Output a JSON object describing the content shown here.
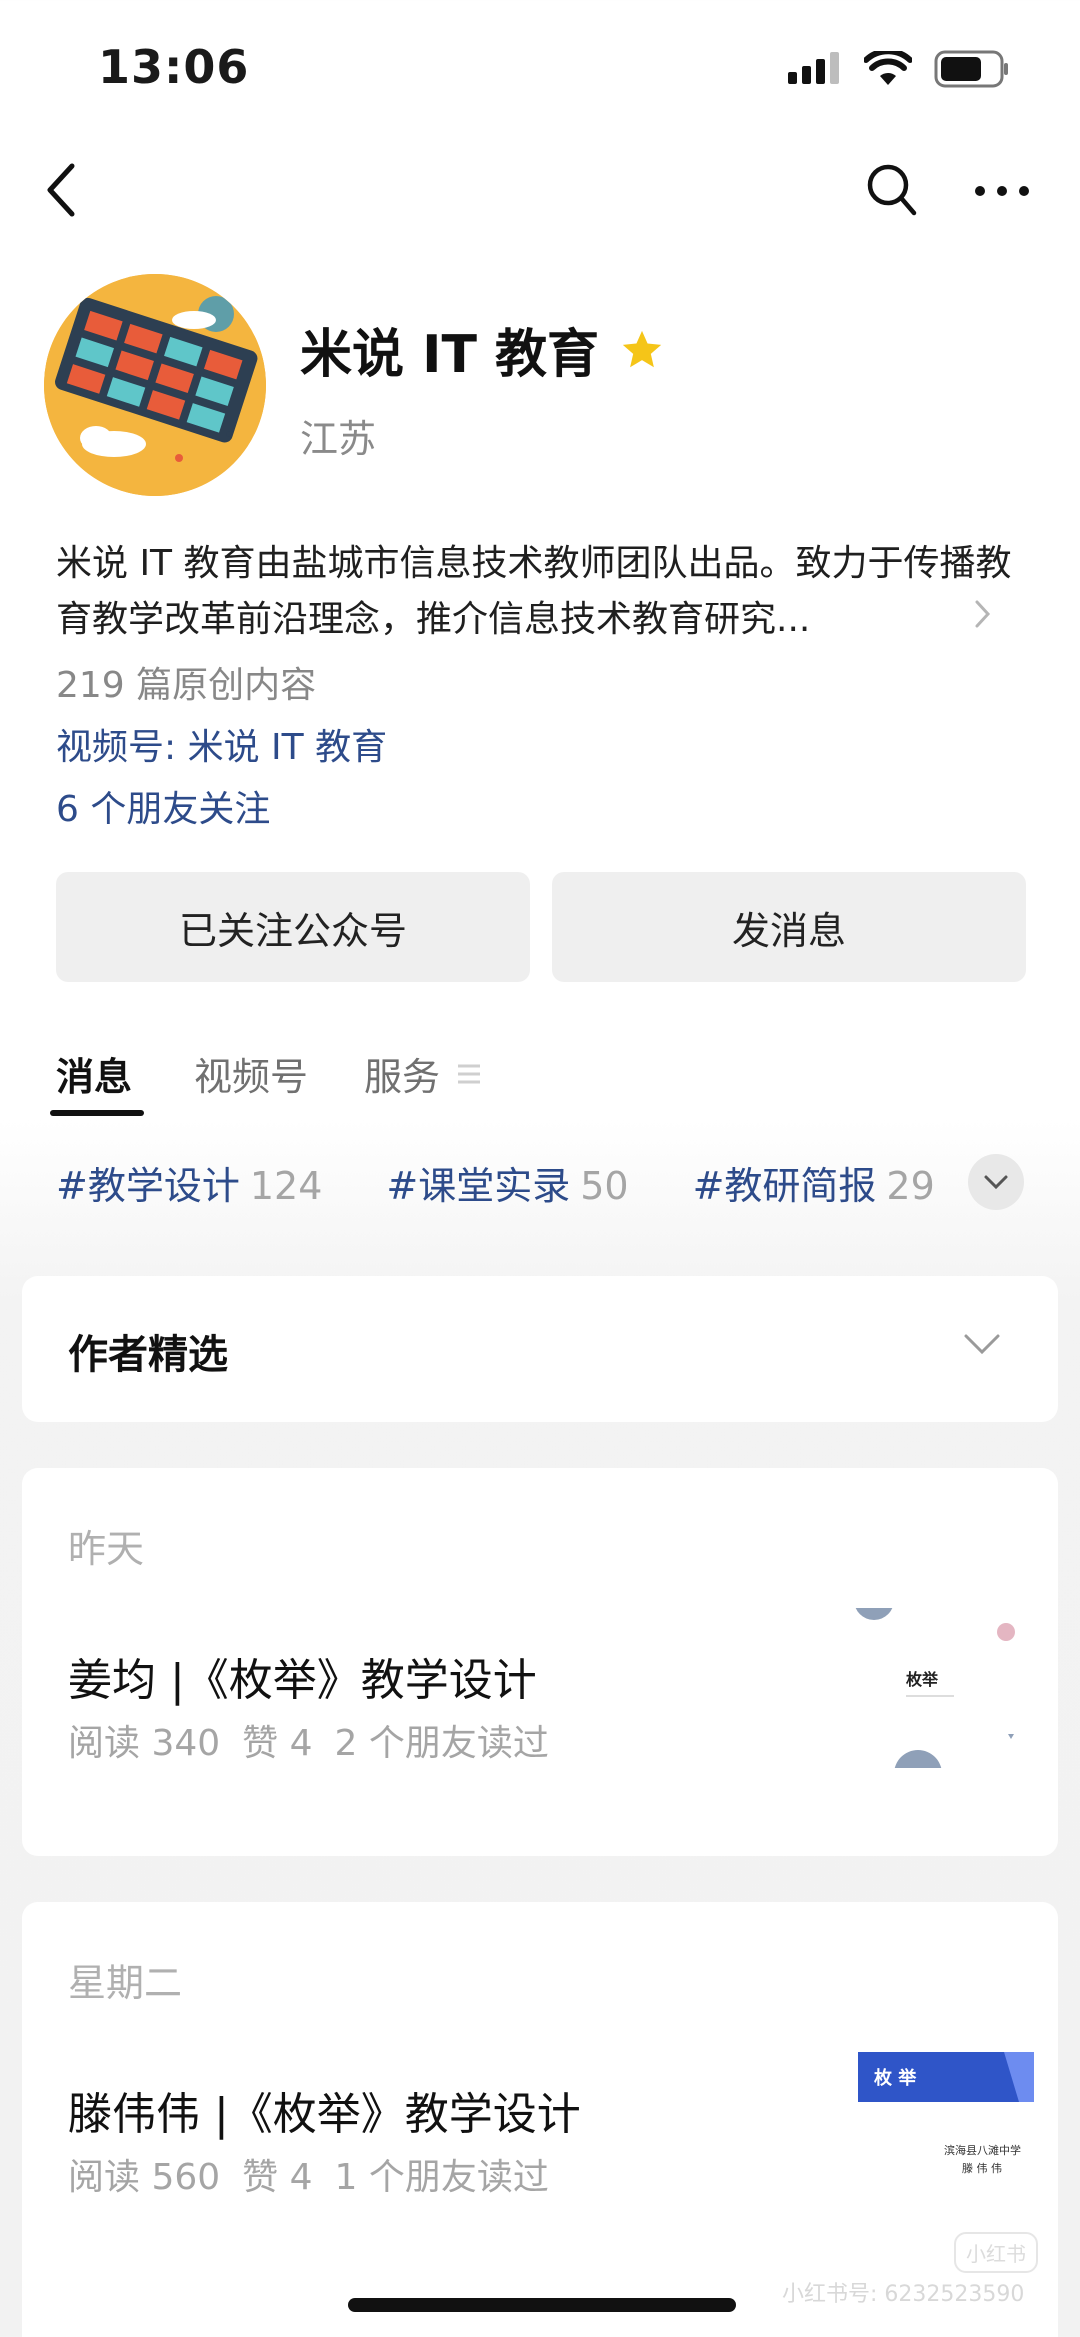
{
  "status": {
    "time": "13:06"
  },
  "profile": {
    "name": "米说 IT 教育",
    "region": "江苏",
    "bio": "米说 IT 教育由盐城市信息技术教师团队出品。致力于传播教育教学改革前沿理念，推介信息技术教育研究...",
    "original_count": "219 篇原创内容",
    "video_account": "视频号: 米说 IT 教育",
    "friends_following": "6 个朋友关注"
  },
  "buttons": {
    "followed": "已关注公众号",
    "message": "发消息"
  },
  "tabs": [
    {
      "label": "消息"
    },
    {
      "label": "视频号"
    },
    {
      "label": "服务"
    }
  ],
  "tags": [
    {
      "label": "#教学设计",
      "count": "124"
    },
    {
      "label": "#课堂实录",
      "count": "50"
    },
    {
      "label": "#教研简报",
      "count": "29"
    }
  ],
  "author_select": {
    "title": "作者精选"
  },
  "articles": [
    {
      "date": "昨天",
      "title": "姜均 |《枚举》教学设计",
      "reads": "阅读 340",
      "likes": "赞 4",
      "friends": "2 个朋友读过",
      "thumb_text": "枚举"
    },
    {
      "date": "星期二",
      "title": "滕伟伟 |《枚举》教学设计",
      "reads": "阅读 560",
      "likes": "赞 4",
      "friends": "1 个朋友读过",
      "thumb_text": "枚 举",
      "thumb_sub": "滨海县八滩中学",
      "thumb_author": "滕 伟 伟"
    }
  ],
  "watermark": {
    "text": "小红书号: 6232523590",
    "logo": "小红书"
  },
  "colors": {
    "link": "#2d4b8a",
    "star": "#f5c518",
    "avatar_bg": "#f4b53f"
  }
}
